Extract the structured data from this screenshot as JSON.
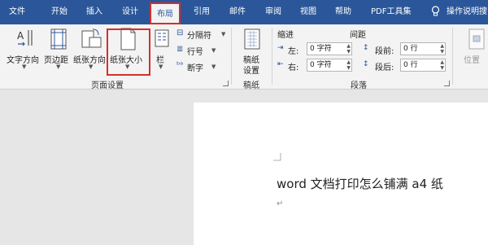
{
  "tabs": [
    "文件",
    "开始",
    "插入",
    "设计",
    "布局",
    "引用",
    "邮件",
    "审阅",
    "视图",
    "帮助",
    "PDF工具集"
  ],
  "tell_me": "操作说明搜",
  "ribbon": {
    "page_setup": {
      "text_direction": "文字方向",
      "margins": "页边距",
      "orientation": "纸张方向",
      "size": "纸张大小",
      "columns": "栏",
      "breaks": "分隔符",
      "line_numbers": "行号",
      "hyphenation": "断字",
      "group_label": "页面设置"
    },
    "manuscript": {
      "button_line1": "稿纸",
      "button_line2": "设置",
      "group_label": "稿纸"
    },
    "paragraph": {
      "indent_heading": "缩进",
      "spacing_heading": "间距",
      "left_label": "左:",
      "left_value": "0 字符",
      "right_label": "右:",
      "right_value": "0 字符",
      "before_label": "段前:",
      "before_value": "0 行",
      "after_label": "段后:",
      "after_value": "0 行",
      "group_label": "段落"
    },
    "arrange": {
      "position": "位置"
    }
  },
  "document": {
    "text": "word 文档打印怎么铺满 a4 纸"
  }
}
